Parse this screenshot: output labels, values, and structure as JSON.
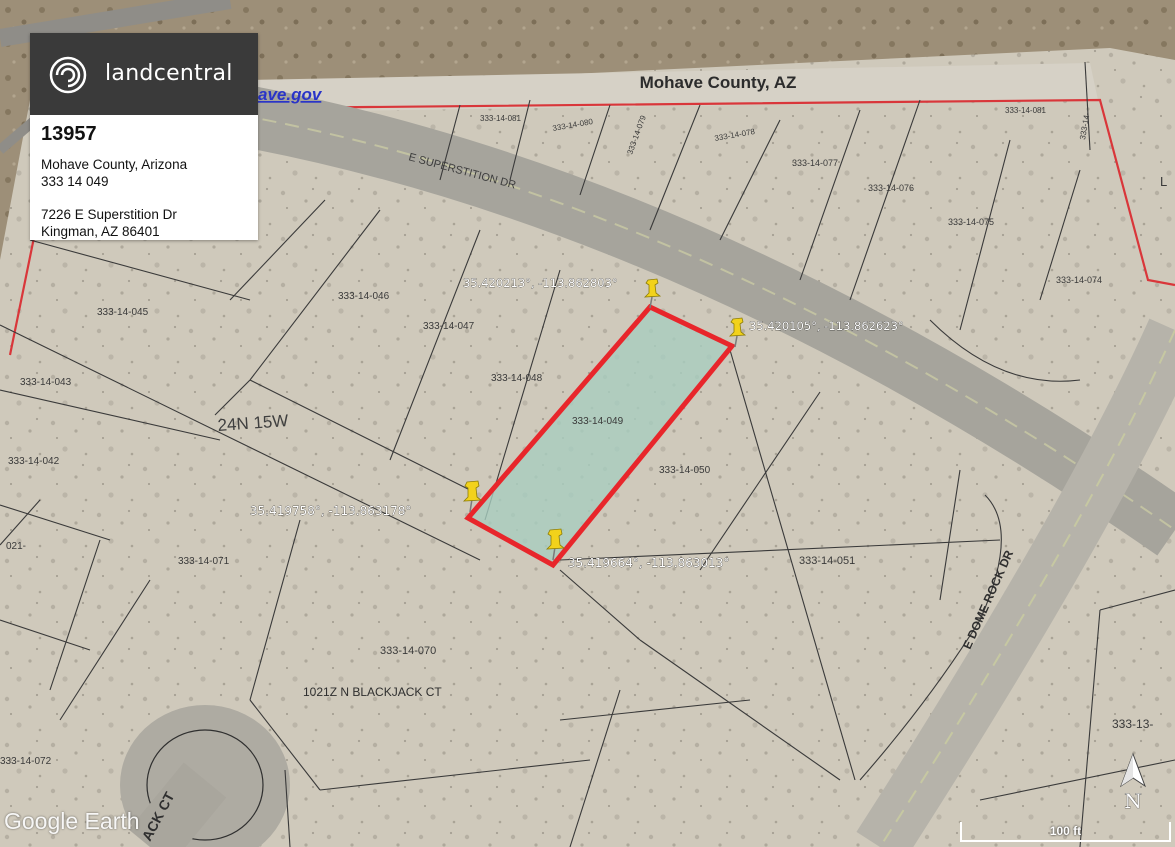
{
  "brand": {
    "name": "landcentral"
  },
  "property": {
    "id": "13957",
    "county_state": "Mohave County, Arizona",
    "apn": "333 14 049",
    "street": "7226 E Superstition Dr",
    "city_state_zip": "Kingman, AZ 86401"
  },
  "map": {
    "county_banner": "Mohave County, AZ",
    "url_fragment": "ave.gov",
    "township_range": "24N 15W",
    "roads": {
      "superstition": "E SUPERSTITION DR",
      "dome_rock": "E DOME ROCK DR",
      "blackjack": "1021Z N BLACKJACK CT",
      "jack_ct": "ACK CT"
    },
    "parcels": [
      "333-14-081",
      "333-14-080",
      "333-14-079",
      "333-14-078",
      "333-14-077",
      "333-14-076",
      "333-14-075",
      "333-14-074",
      "333-14-086",
      "333-14-046",
      "333-14-045",
      "333-14-047",
      "333-14-043",
      "333-14-048",
      "333-14-049",
      "333-14-042",
      "333-14-050",
      "333-14-071",
      "333-14-051",
      "333-14-070",
      "333-14-072",
      "333-13-",
      "021-",
      "L",
      "333-14-"
    ],
    "corners": [
      "35.420213°, -113.862803°",
      "35.420105°, -113.862623°",
      "35.419758°, -113.863178°",
      "35.419664°, -113.863013°"
    ],
    "scale_label": "100 ft",
    "north_label": "N",
    "attribution": "Google Earth"
  },
  "colors": {
    "boundary": "#e8262b",
    "selected_fill": "#a8cdbf",
    "pin": "#f2d21b",
    "county_line": "#d9363a"
  }
}
